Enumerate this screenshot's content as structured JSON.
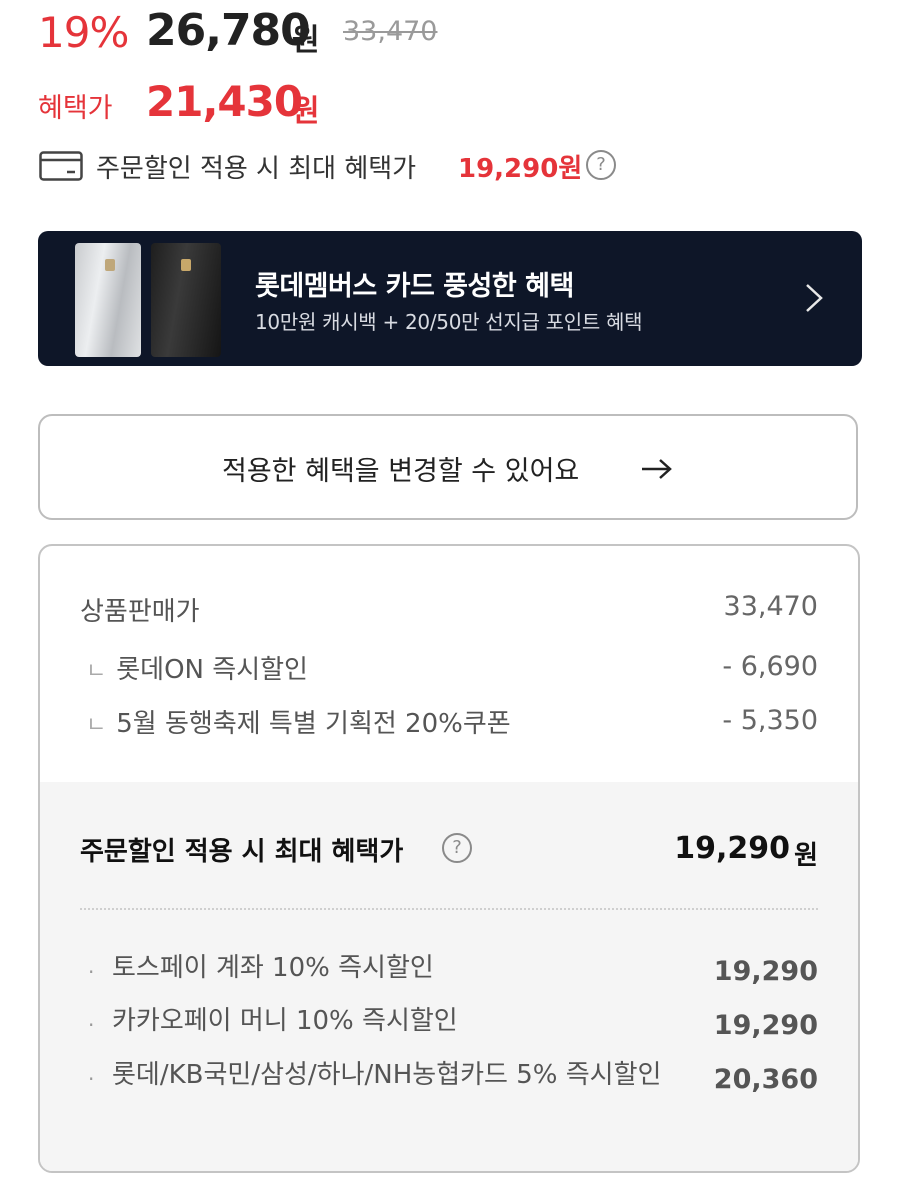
{
  "price": {
    "discount_rate": "19%",
    "sale_price": "26,780",
    "currency": "원",
    "original_price": "33,470"
  },
  "benefit": {
    "label": "혜택가",
    "price": "21,430",
    "currency": "원"
  },
  "max_benefit": {
    "text": "주문할인 적용 시 최대 혜택가",
    "price": "19,290원",
    "help_icon": "?"
  },
  "banner": {
    "title": "롯데멤버스 카드 풍성한 혜택",
    "subtitle": "10만원 캐시백 + 20/50만 선지급 포인트 혜택",
    "bg_color": "#0e1628"
  },
  "change_button": {
    "label": "적용한 혜택을 변경할 수 있어요"
  },
  "breakdown": {
    "rows": [
      {
        "label": "상품판매가",
        "value": "33,470",
        "sub": false
      },
      {
        "label": "롯데ON 즉시할인",
        "value": "- 6,690",
        "sub": true,
        "mark": "ㄴ"
      },
      {
        "label": "5월 동행축제 특별 기획전 20%쿠폰",
        "value": "- 5,350",
        "sub": true,
        "mark": "ㄴ"
      }
    ],
    "total_label": "주문할인 적용 시 최대 혜택가",
    "total_value": "19,290",
    "total_unit": "원",
    "help_icon": "?",
    "payment_offers": [
      {
        "bullet": "·",
        "label": "토스페이 계좌 10% 즉시할인",
        "value": "19,290"
      },
      {
        "bullet": "·",
        "label": "카카오페이 머니 10% 즉시할인",
        "value": "19,290"
      },
      {
        "bullet": "·",
        "label": "롯데/KB국민/삼성/하나/NH농협카드 5% 즉시할인",
        "value": "20,360"
      }
    ]
  },
  "colors": {
    "accent_red": "#e5343a",
    "text_dark": "#222222",
    "muted": "#9a9a9a"
  }
}
